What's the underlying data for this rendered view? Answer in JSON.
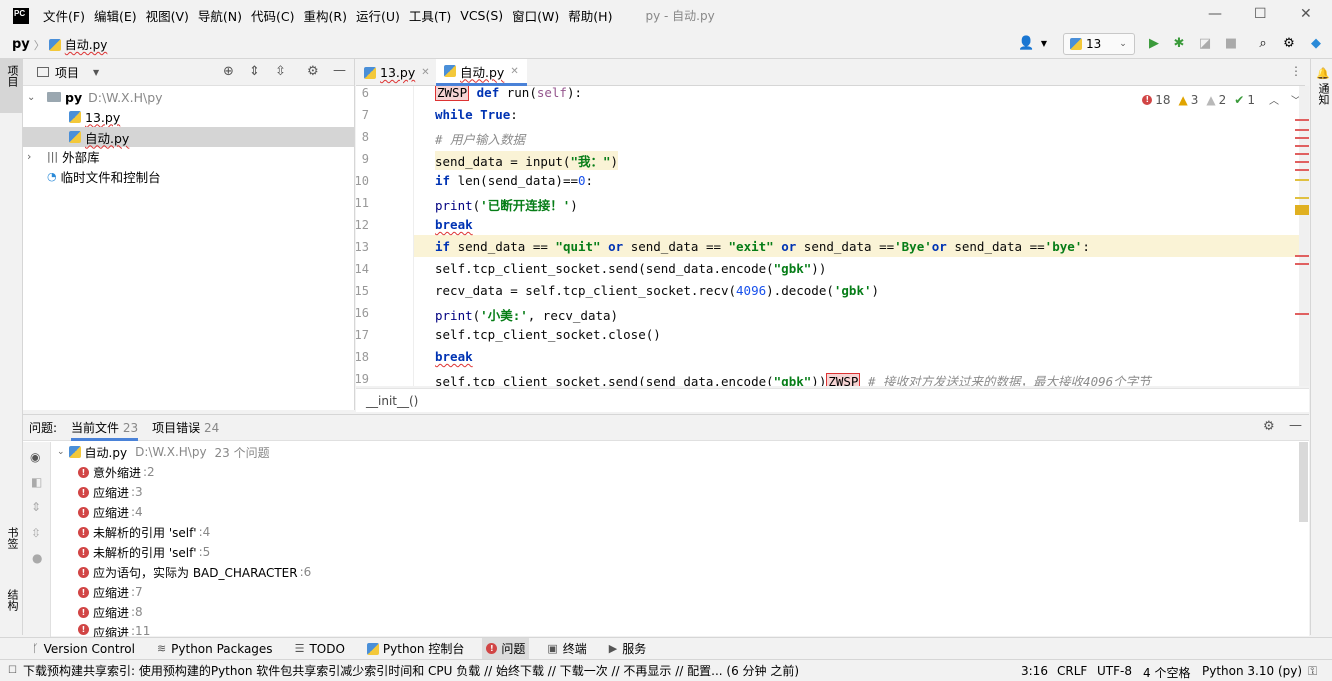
{
  "menubar": {
    "logo": "PC",
    "items": [
      "文件(F)",
      "编辑(E)",
      "视图(V)",
      "导航(N)",
      "代码(C)",
      "重构(R)",
      "运行(U)",
      "工具(T)",
      "VCS(S)",
      "窗口(W)",
      "帮助(H)"
    ],
    "title": "py - 自动.py"
  },
  "navbar": {
    "root": "py",
    "file": "自动.py",
    "run_config": "13"
  },
  "left_strip": {
    "project": "项目",
    "bookmarks": "书签",
    "structure": "结构"
  },
  "right_strip": {
    "notifications": "通知"
  },
  "project": {
    "title": "项目",
    "tree": [
      {
        "name": "py",
        "path": "D:\\W.X.H\\py"
      },
      {
        "name": "13.py"
      },
      {
        "name": "自动.py"
      },
      {
        "name": "外部库"
      },
      {
        "name": "临时文件和控制台"
      }
    ]
  },
  "editor": {
    "tabs": [
      "13.py",
      "自动.py"
    ],
    "inspection": {
      "errors": "18",
      "warnings": "3",
      "weak": "2",
      "ok": "1"
    },
    "line_numbers": [
      "6",
      "7",
      "8",
      "9",
      "10",
      "11",
      "12",
      "13",
      "14",
      "15",
      "16",
      "17",
      "18",
      "19"
    ],
    "breadcrumb": "__init__()"
  },
  "problems": {
    "label": "问题:",
    "tab_current": "当前文件",
    "tab_current_count": "23",
    "tab_project": "项目错误",
    "tab_project_count": "24",
    "file": "自动.py",
    "file_path": "D:\\W.X.H\\py",
    "file_count": "23 个问题",
    "items": [
      {
        "msg": "意外缩进",
        "loc": ":2"
      },
      {
        "msg": "应缩进",
        "loc": ":3"
      },
      {
        "msg": "应缩进",
        "loc": ":4"
      },
      {
        "msg": "未解析的引用 'self'",
        "loc": ":4"
      },
      {
        "msg": "未解析的引用 'self'",
        "loc": ":5"
      },
      {
        "msg": "应为语句，实际为 BAD_CHARACTER",
        "loc": ":6"
      },
      {
        "msg": "应缩进",
        "loc": ":7"
      },
      {
        "msg": "应缩进",
        "loc": ":8"
      },
      {
        "msg": "应缩进",
        "loc": ":11"
      }
    ]
  },
  "bottom_tools": [
    "Version Control",
    "Python Packages",
    "TODO",
    "Python 控制台",
    "问题",
    "终端",
    "服务"
  ],
  "status": {
    "message": "下载预构建共享索引: 使用预构建的Python 软件包共享索引减少索引时间和 CPU 负载 // 始终下载 // 下载一次 // 不再显示 // 配置... (6 分钟 之前)",
    "position": "3:16",
    "line_sep": "CRLF",
    "encoding": "UTF-8",
    "indent": "4 个空格",
    "interpreter": "Python 3.10 (py)"
  }
}
